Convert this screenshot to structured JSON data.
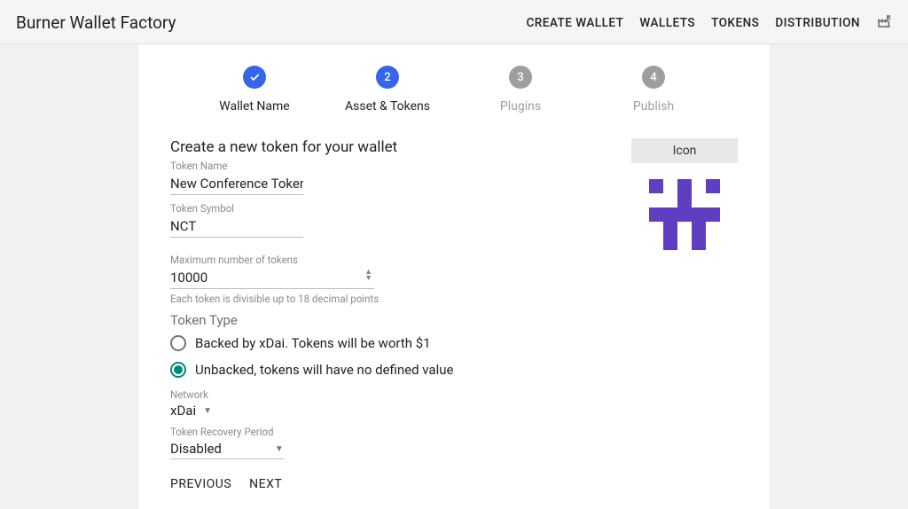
{
  "header": {
    "brand": "Burner Wallet Factory",
    "nav": [
      "CREATE WALLET",
      "WALLETS",
      "TOKENS",
      "DISTRIBUTION"
    ]
  },
  "stepper": [
    {
      "label": "Wallet Name",
      "state": "done"
    },
    {
      "label": "Asset & Tokens",
      "state": "active",
      "num": "2"
    },
    {
      "label": "Plugins",
      "state": "todo",
      "num": "3"
    },
    {
      "label": "Publish",
      "state": "todo",
      "num": "4"
    }
  ],
  "form": {
    "title": "Create a new token for your wallet",
    "tokenName": {
      "label": "Token Name",
      "value": "New Conference Token"
    },
    "tokenSymbol": {
      "label": "Token Symbol",
      "value": "NCT"
    },
    "maxTokens": {
      "label": "Maximum number of tokens",
      "value": "10000",
      "helper": "Each token is divisible up to 18 decimal points"
    },
    "tokenTypeLabel": "Token Type",
    "radios": {
      "backed": "Backed by xDai. Tokens will be worth $1",
      "unbacked": "Unbacked, tokens will have no defined value",
      "selected": "unbacked"
    },
    "network": {
      "label": "Network",
      "value": "xDai"
    },
    "recovery": {
      "label": "Token Recovery Period",
      "value": "Disabled"
    }
  },
  "iconPanel": {
    "label": "Icon"
  },
  "buttons": {
    "prev": "PREVIOUS",
    "next": "NEXT"
  },
  "colors": {
    "blockie": "#5f3ec1"
  }
}
